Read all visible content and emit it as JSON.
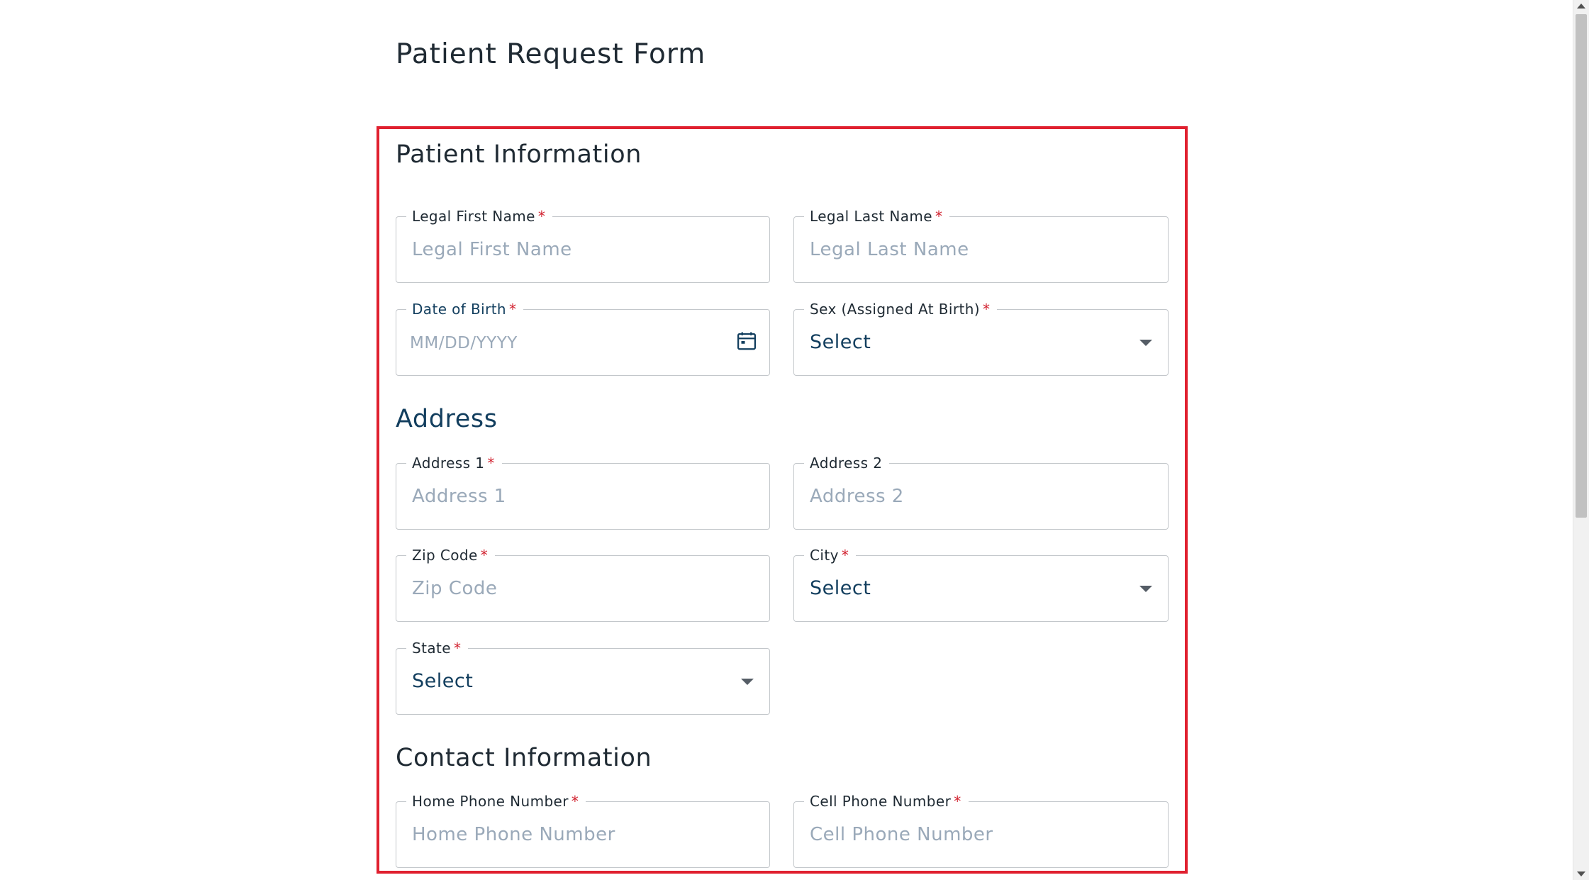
{
  "page_title": "Patient Request Form",
  "sections": {
    "patient_info": {
      "title": "Patient Information"
    },
    "address": {
      "title": "Address"
    },
    "contact": {
      "title": "Contact Information"
    }
  },
  "fields": {
    "first_name": {
      "label": "Legal First Name",
      "required": "*",
      "placeholder": "Legal First Name"
    },
    "last_name": {
      "label": "Legal Last Name",
      "required": "*",
      "placeholder": "Legal Last Name"
    },
    "dob": {
      "label": "Date of Birth",
      "required": "*",
      "placeholder": "MM/DD/YYYY",
      "icon": "calendar-icon"
    },
    "sex": {
      "label": "Sex (Assigned At Birth)",
      "required": "*",
      "value": "Select"
    },
    "address1": {
      "label": "Address 1",
      "required": "*",
      "placeholder": "Address 1"
    },
    "address2": {
      "label": "Address 2",
      "placeholder": "Address 2"
    },
    "zip": {
      "label": "Zip Code",
      "required": "*",
      "placeholder": "Zip Code"
    },
    "city": {
      "label": "City",
      "required": "*",
      "value": "Select"
    },
    "state": {
      "label": "State",
      "required": "*",
      "value": "Select"
    },
    "home_phone": {
      "label": "Home Phone Number",
      "required": "*",
      "placeholder": "Home Phone Number"
    },
    "cell_phone": {
      "label": "Cell Phone Number",
      "required": "*",
      "placeholder": "Cell Phone Number"
    }
  },
  "colors": {
    "highlight_border": "#e0202f",
    "required_mark": "#d11f2d",
    "section_accent": "#123e5e",
    "placeholder": "#9aa9b9"
  }
}
